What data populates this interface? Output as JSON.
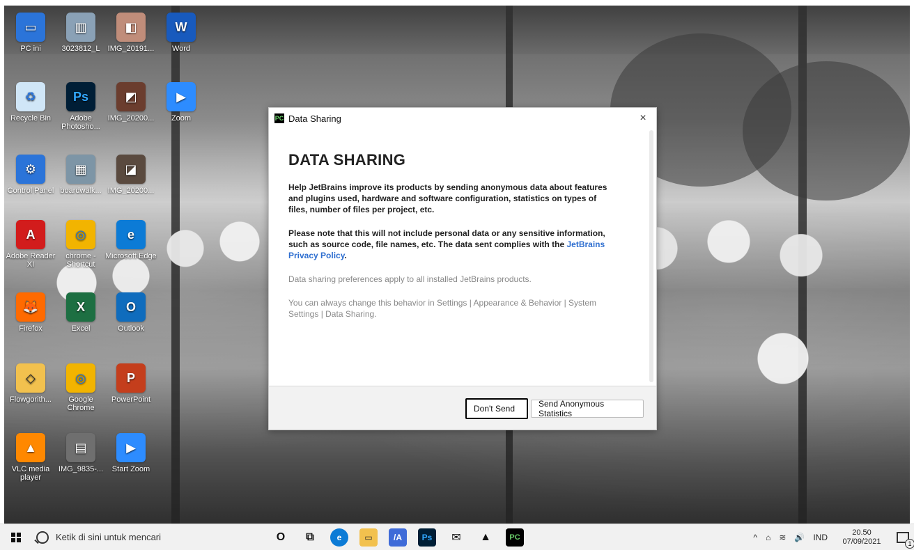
{
  "desktop": {
    "icons": [
      {
        "label": "PC ini",
        "icon": "computer-icon",
        "color": "#2b74d9"
      },
      {
        "label": "3023812_L",
        "icon": "image-icon",
        "color": "#8aa1b6"
      },
      {
        "label": "IMG_20191...",
        "icon": "photo-icon",
        "color": "#c08d7a"
      },
      {
        "label": "Word",
        "icon": "word-icon",
        "color": "#185abd"
      },
      {
        "label": "Recycle Bin",
        "icon": "recycle-bin-icon",
        "color": "#d0e6f7"
      },
      {
        "label": "Adobe Photosho...",
        "icon": "photoshop-icon",
        "color": "#001e36"
      },
      {
        "label": "IMG_20200...",
        "icon": "photo-icon",
        "color": "#6b3d2e"
      },
      {
        "label": "Zoom",
        "icon": "zoom-icon",
        "color": "#2d8cff"
      },
      {
        "label": "Control Panel",
        "icon": "control-panel-icon",
        "color": "#2b74d9"
      },
      {
        "label": "boardwalk...",
        "icon": "image-icon",
        "color": "#7d95a6"
      },
      {
        "label": "IMG_20200...",
        "icon": "photo-icon",
        "color": "#5a4a3f"
      },
      {
        "label": "Adobe Reader XI",
        "icon": "pdf-icon",
        "color": "#d21c1c"
      },
      {
        "label": "chrome - Shortcut",
        "icon": "chrome-icon",
        "color": "#f2b400"
      },
      {
        "label": "Microsoft Edge",
        "icon": "edge-icon",
        "color": "#0c7bd6"
      },
      {
        "label": "Firefox",
        "icon": "firefox-icon",
        "color": "#ff6a00"
      },
      {
        "label": "Excel",
        "icon": "excel-icon",
        "color": "#1d6f42"
      },
      {
        "label": "Outlook",
        "icon": "outlook-icon",
        "color": "#0f6cbd"
      },
      {
        "label": "Flowgorith...",
        "icon": "flowgorithm-icon",
        "color": "#f2c14e"
      },
      {
        "label": "Google Chrome",
        "icon": "chrome-icon",
        "color": "#f2b400"
      },
      {
        "label": "PowerPoint",
        "icon": "powerpoint-icon",
        "color": "#c43e1c"
      },
      {
        "label": "VLC media player",
        "icon": "vlc-icon",
        "color": "#ff8800"
      },
      {
        "label": "IMG_9835-...",
        "icon": "photo-icon",
        "color": "#6f6f6f"
      },
      {
        "label": "Start Zoom",
        "icon": "zoom-icon",
        "color": "#2d8cff"
      }
    ]
  },
  "dialog": {
    "title": "Data Sharing",
    "app_icon_text": "PC",
    "close_glyph": "×",
    "heading": "DATA SHARING",
    "p1": "Help JetBrains improve its products by sending anonymous data about features and plugins used, hardware and software configuration, statistics on types of files, number of files per project, etc.",
    "p2_before_link": "Please note that this will not include personal data or any sensitive information, such as source code, file names, etc. The data sent complies with the ",
    "p2_link": "JetBrains Privacy Policy",
    "p2_after_link": ".",
    "p3": "Data sharing preferences apply to all installed JetBrains products.",
    "p4": "You can always change this behavior in Settings | Appearance & Behavior | System Settings | Data Sharing.",
    "buttons": {
      "dont_send": "Don't Send",
      "send_stats": "Send Anonymous Statistics"
    }
  },
  "taskbar": {
    "search_placeholder": "Ketik di sini untuk mencari",
    "apps": [
      {
        "icon": "cortana-icon",
        "text": "O",
        "color": "#111111"
      },
      {
        "icon": "task-view-icon",
        "text": "⧉",
        "color": "#111111"
      },
      {
        "icon": "edge-icon",
        "text": "e",
        "color": "#0c7bd6"
      },
      {
        "icon": "file-explorer-icon",
        "text": "▭",
        "color": "#f2c14e"
      },
      {
        "icon": "pinned-app-icon",
        "text": "/A",
        "color": "#3f6bd8"
      },
      {
        "icon": "photoshop-icon",
        "text": "Ps",
        "color": "#001e36"
      },
      {
        "icon": "mail-icon",
        "text": "✉",
        "color": "#111111"
      },
      {
        "icon": "photos-icon",
        "text": "▲",
        "color": "#111111"
      },
      {
        "icon": "pycharm-icon",
        "text": "PC",
        "color": "#000000"
      }
    ],
    "tray": {
      "chevron": "^",
      "network": "⌂",
      "wifi": "≋",
      "volume": "🔊",
      "lang": "IND",
      "time": "20.50",
      "date": "07/09/2021",
      "notifications_count": "1"
    }
  }
}
